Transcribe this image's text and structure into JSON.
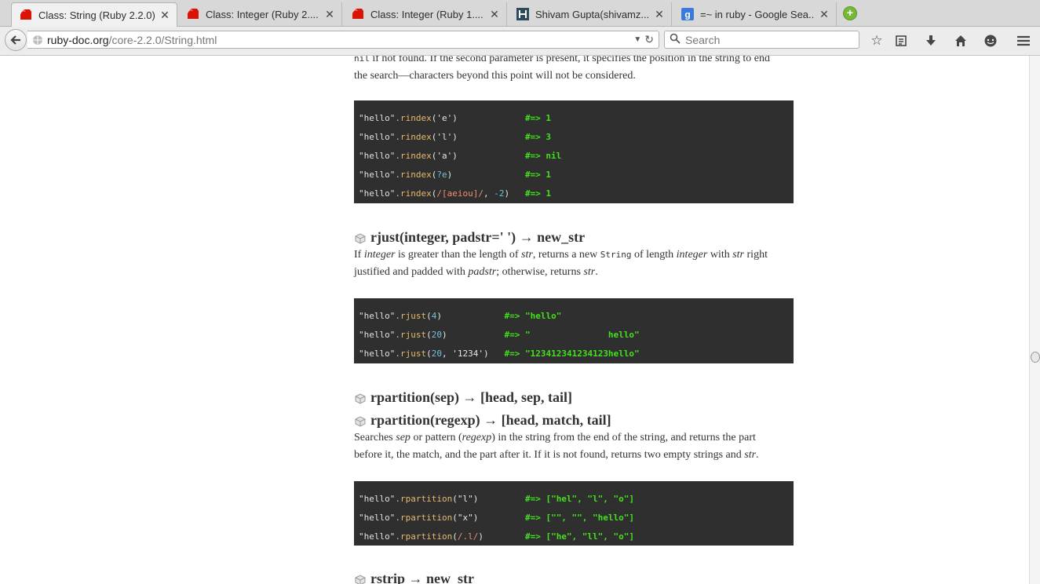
{
  "browser": {
    "tabs": [
      {
        "title": "Class: String (Ruby 2.2.0)",
        "active": true,
        "icon": "ruby-icon"
      },
      {
        "title": "Class: Integer (Ruby 2....",
        "active": false,
        "icon": "ruby-icon"
      },
      {
        "title": "Class: Integer (Ruby 1....",
        "active": false,
        "icon": "ruby-icon"
      },
      {
        "title": "Shivam Gupta(shivamz...",
        "active": false,
        "icon": "hackerrank-icon"
      },
      {
        "title": "=~ in ruby - Google Sea...",
        "active": false,
        "icon": "google-icon"
      }
    ],
    "url_domain": "ruby-doc.org",
    "url_path": "/core-2.2.0/String.html",
    "search_placeholder": "Search"
  },
  "doc": {
    "top_para_code": "nil",
    "top_para_1": " if not found. If the second parameter is present, it specifies the position in the string to end",
    "top_para_2": "the search—characters beyond this point will not be considered.",
    "rindex_code": [
      {
        "recv": "\"hello\"",
        "meth": ".rindex",
        "args": [
          [
            "p",
            "("
          ],
          [
            "s",
            "'e'"
          ],
          [
            "p",
            ")"
          ]
        ],
        "result": "#=> 1"
      },
      {
        "recv": "\"hello\"",
        "meth": ".rindex",
        "args": [
          [
            "p",
            "("
          ],
          [
            "s",
            "'l'"
          ],
          [
            "p",
            ")"
          ]
        ],
        "result": "#=> 3"
      },
      {
        "recv": "\"hello\"",
        "meth": ".rindex",
        "args": [
          [
            "p",
            "("
          ],
          [
            "s",
            "'a'"
          ],
          [
            "p",
            ")"
          ]
        ],
        "result": "#=> nil"
      },
      {
        "recv": "\"hello\"",
        "meth": ".rindex",
        "args": [
          [
            "p",
            "("
          ],
          [
            "n",
            "?e"
          ],
          [
            "p",
            ")"
          ]
        ],
        "result": "#=> 1"
      },
      {
        "recv": "\"hello\"",
        "meth": ".rindex",
        "args": [
          [
            "p",
            "("
          ],
          [
            "r",
            "/[aeiou]/"
          ],
          [
            "p",
            ", "
          ],
          [
            "n",
            "-2"
          ],
          [
            "p",
            ")"
          ]
        ],
        "result": "#=> 1"
      }
    ],
    "rjust_heading": "rjust(integer, padstr=' ') → new_str",
    "rjust_desc": {
      "t1": "If ",
      "i1": "integer",
      "t2": " is greater than the length of ",
      "i2": "str",
      "t3": ", returns a new ",
      "c1": "String",
      "t4": " of length ",
      "i3": "integer",
      "t5": " with ",
      "i4": "str",
      "t6": " right",
      "t7": "justified and padded with ",
      "i5": "padstr",
      "t8": "; otherwise, returns ",
      "i6": "str",
      "t9": "."
    },
    "rjust_code": [
      {
        "recv": "\"hello\"",
        "meth": ".rjust",
        "args": [
          [
            "p",
            "("
          ],
          [
            "n",
            "4"
          ],
          [
            "p",
            ")"
          ]
        ],
        "result": "#=> \"hello\""
      },
      {
        "recv": "\"hello\"",
        "meth": ".rjust",
        "args": [
          [
            "p",
            "("
          ],
          [
            "n",
            "20"
          ],
          [
            "p",
            ")"
          ]
        ],
        "result": "#=> \"               hello\""
      },
      {
        "recv": "\"hello\"",
        "meth": ".rjust",
        "args": [
          [
            "p",
            "("
          ],
          [
            "n",
            "20"
          ],
          [
            "p",
            ", "
          ],
          [
            "s",
            "'1234'"
          ],
          [
            "p",
            ")"
          ]
        ],
        "result": "#=> \"123412341234123hello\""
      }
    ],
    "rpartition_heading_1": "rpartition(sep) → [head, sep, tail]",
    "rpartition_heading_2": "rpartition(regexp) → [head, match, tail]",
    "rpartition_desc": {
      "t1": "Searches ",
      "i1": "sep",
      "t2": " or pattern (",
      "i2": "regexp",
      "t3": ") in the string from the end of the string, and returns the part",
      "t4": "before it, the match, and the part after it. If it is not found, returns two empty strings and ",
      "i3": "str",
      "t5": "."
    },
    "rpartition_code": [
      {
        "recv": "\"hello\"",
        "meth": ".rpartition",
        "args": [
          [
            "p",
            "("
          ],
          [
            "s",
            "\"l\""
          ],
          [
            "p",
            ")"
          ]
        ],
        "result": "#=> [\"hel\", \"l\", \"o\"]"
      },
      {
        "recv": "\"hello\"",
        "meth": ".rpartition",
        "args": [
          [
            "p",
            "("
          ],
          [
            "s",
            "\"x\""
          ],
          [
            "p",
            ")"
          ]
        ],
        "result": "#=> [\"\", \"\", \"hello\"]"
      },
      {
        "recv": "\"hello\"",
        "meth": ".rpartition",
        "args": [
          [
            "p",
            "("
          ],
          [
            "r",
            "/.l/"
          ],
          [
            "p",
            ")"
          ]
        ],
        "result": "#=> [\"he\", \"ll\", \"o\"]"
      }
    ],
    "rstrip_heading": "rstrip → new_str"
  }
}
